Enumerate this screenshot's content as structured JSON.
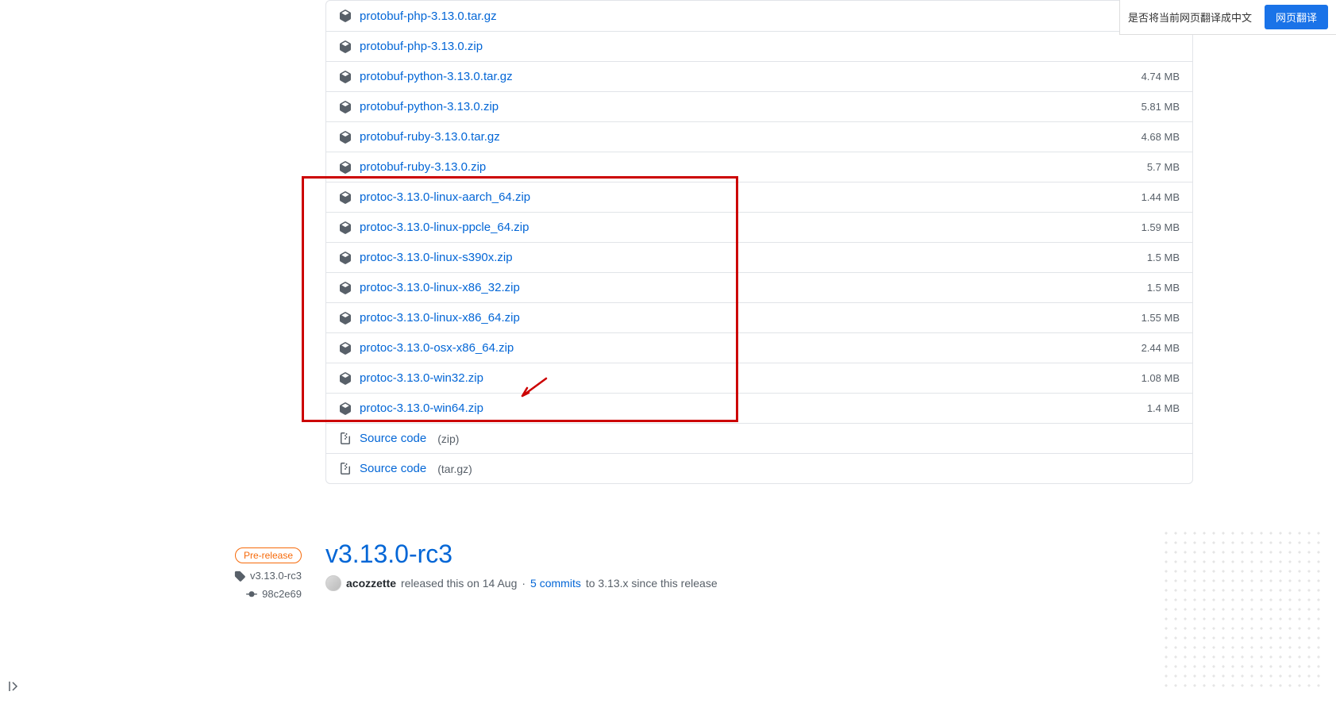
{
  "translate": {
    "prompt": "是否将当前网页翻译成中文",
    "button": "网页翻译"
  },
  "sidebar": {
    "prerelease": "Pre-release",
    "tag": "v3.13.0-rc3",
    "commit": "98c2e69"
  },
  "assets": [
    {
      "name": "protobuf-php-3.13.0.tar.gz",
      "size": "",
      "type": "package"
    },
    {
      "name": "protobuf-php-3.13.0.zip",
      "size": "",
      "type": "package"
    },
    {
      "name": "protobuf-python-3.13.0.tar.gz",
      "size": "4.74 MB",
      "type": "package"
    },
    {
      "name": "protobuf-python-3.13.0.zip",
      "size": "5.81 MB",
      "type": "package"
    },
    {
      "name": "protobuf-ruby-3.13.0.tar.gz",
      "size": "4.68 MB",
      "type": "package"
    },
    {
      "name": "protobuf-ruby-3.13.0.zip",
      "size": "5.7 MB",
      "type": "package"
    },
    {
      "name": "protoc-3.13.0-linux-aarch_64.zip",
      "size": "1.44 MB",
      "type": "package"
    },
    {
      "name": "protoc-3.13.0-linux-ppcle_64.zip",
      "size": "1.59 MB",
      "type": "package"
    },
    {
      "name": "protoc-3.13.0-linux-s390x.zip",
      "size": "1.5 MB",
      "type": "package"
    },
    {
      "name": "protoc-3.13.0-linux-x86_32.zip",
      "size": "1.5 MB",
      "type": "package"
    },
    {
      "name": "protoc-3.13.0-linux-x86_64.zip",
      "size": "1.55 MB",
      "type": "package"
    },
    {
      "name": "protoc-3.13.0-osx-x86_64.zip",
      "size": "2.44 MB",
      "type": "package"
    },
    {
      "name": "protoc-3.13.0-win32.zip",
      "size": "1.08 MB",
      "type": "package"
    },
    {
      "name": "protoc-3.13.0-win64.zip",
      "size": "1.4 MB",
      "type": "package"
    },
    {
      "name": "Source code",
      "ext": "(zip)",
      "size": "",
      "type": "source"
    },
    {
      "name": "Source code",
      "ext": "(tar.gz)",
      "size": "",
      "type": "source"
    }
  ],
  "release": {
    "title": "v3.13.0-rc3",
    "author": "acozzette",
    "released_text": "released this on 14 Aug",
    "sep": "·",
    "commits_link": "5 commits",
    "since_text": "to 3.13.x since this release"
  }
}
